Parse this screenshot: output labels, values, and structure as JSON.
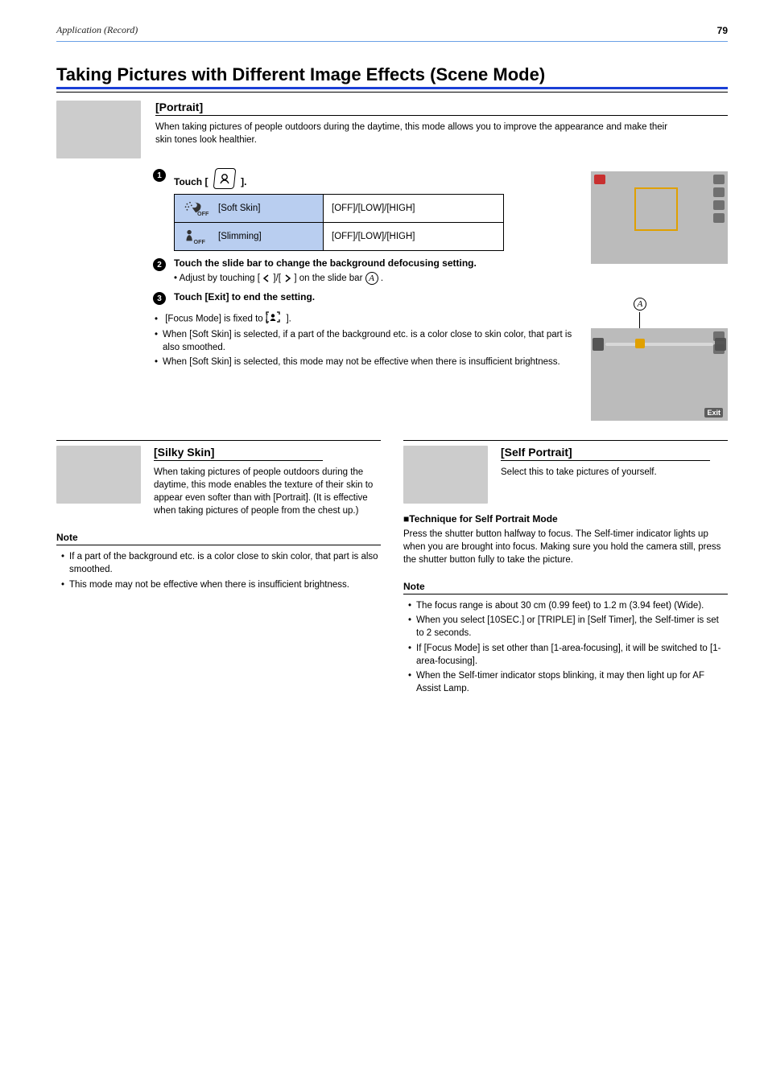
{
  "header": {
    "breadcrumb": "Application (Record)",
    "page_number": "79"
  },
  "section_title": "Taking Pictures with Different Image Effects (Scene Mode)",
  "portrait": {
    "title": "[Portrait]",
    "description": "When taking pictures of people outdoors during the daytime, this mode allows you to improve the appearance and make their skin tones look healthier.",
    "step1_prefix": "Touch [",
    "step1_suffix": "].",
    "option1_label": "[Soft Skin]",
    "option1_range": "[OFF]/[LOW]/[HIGH]",
    "option2_label": "[Slimming]",
    "option2_range": "[OFF]/[LOW]/[HIGH]",
    "step2_line1": "Touch the slide bar to change the background defocusing setting.",
    "step2_line2_prefix": "• Adjust by touching [",
    "step2_line2_mid": "]/[",
    "step2_line2_end": "] on the slide bar ",
    "step2_line2_tail": ".",
    "step3": "Touch [Exit] to end the setting.",
    "notes": [
      {
        "prefix": "[Focus Mode] is fixed to [",
        "suffix": "]."
      },
      {
        "text": "When [Soft Skin] is selected, if a part of the background etc. is a color close to skin color, that part is also smoothed."
      },
      {
        "text": "When [Soft Skin] is selected, this mode may not be effective when there is insufficient brightness."
      }
    ],
    "left_arrow": "<",
    "right_arrow": ">",
    "exit_label": "Exit",
    "circle_a": "A"
  },
  "silky_skin": {
    "title": "[Silky Skin]",
    "description": "When taking pictures of people outdoors during the daytime, this mode enables the texture of their skin to appear even softer than with [Portrait]. (It is effective when taking pictures of people from the chest up.)",
    "note_heading": "Note",
    "notes": [
      "If a part of the background etc. is a color close to skin color, that part is also smoothed.",
      "This mode may not be effective when there is insufficient brightness."
    ]
  },
  "self_portrait": {
    "title": "[Self Portrait]",
    "description": "Select this to take pictures of yourself.",
    "technique_heading": "■Technique for Self Portrait Mode",
    "technique_body": "Press the shutter button halfway to focus. The Self-timer indicator lights up when you are brought into focus. Making sure you hold the camera still, press the shutter button fully to take the picture.",
    "note_heading": "Note",
    "notes": [
      "The focus range is about 30 cm (0.99 feet) to 1.2 m (3.94 feet) (Wide).",
      "When you select [10SEC.] or [TRIPLE] in [Self Timer], the Self-timer is set to 2 seconds.",
      "If [Focus Mode] is set other than [1-area-focusing], it will be switched to [1-area-focusing].",
      "When the Self-timer indicator stops blinking, it may then light up for AF Assist Lamp."
    ]
  }
}
